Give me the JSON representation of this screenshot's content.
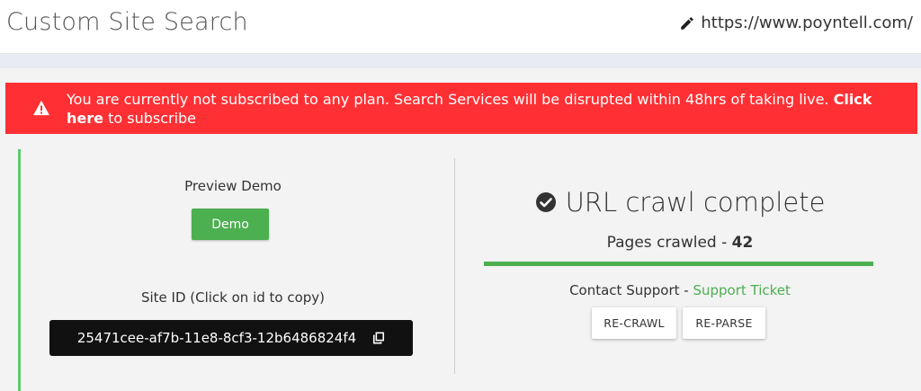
{
  "header": {
    "title": "Custom Site Search",
    "site_url": "https://www.poyntell.com/",
    "edit_icon": "pencil-icon"
  },
  "alert": {
    "icon": "warning-icon",
    "message": "You are currently not subscribed to any plan. Search Services will be disrupted within 48hrs of taking live.",
    "link_label": "Click here",
    "suffix": "to subscribe",
    "color": "#ff3034"
  },
  "preview": {
    "label": "Preview Demo",
    "button_label": "Demo"
  },
  "site_id": {
    "label": "Site ID (Click on id to copy)",
    "value": "25471cee-af7b-11e8-8cf3-12b6486824f4",
    "copy_icon": "copy-icon"
  },
  "crawl": {
    "status_icon": "check-circle-icon",
    "status": "URL crawl complete",
    "pages_label": "Pages crawled -",
    "pages_count": "42",
    "progress_percent": 100
  },
  "support": {
    "prefix": "Contact Support -",
    "link_label": "Support Ticket"
  },
  "actions": {
    "recrawl_label": "RE-CRAWL",
    "reparse_label": "RE-PARSE"
  },
  "colors": {
    "accent_green": "#4caf50",
    "card_border": "#5cc86d"
  }
}
